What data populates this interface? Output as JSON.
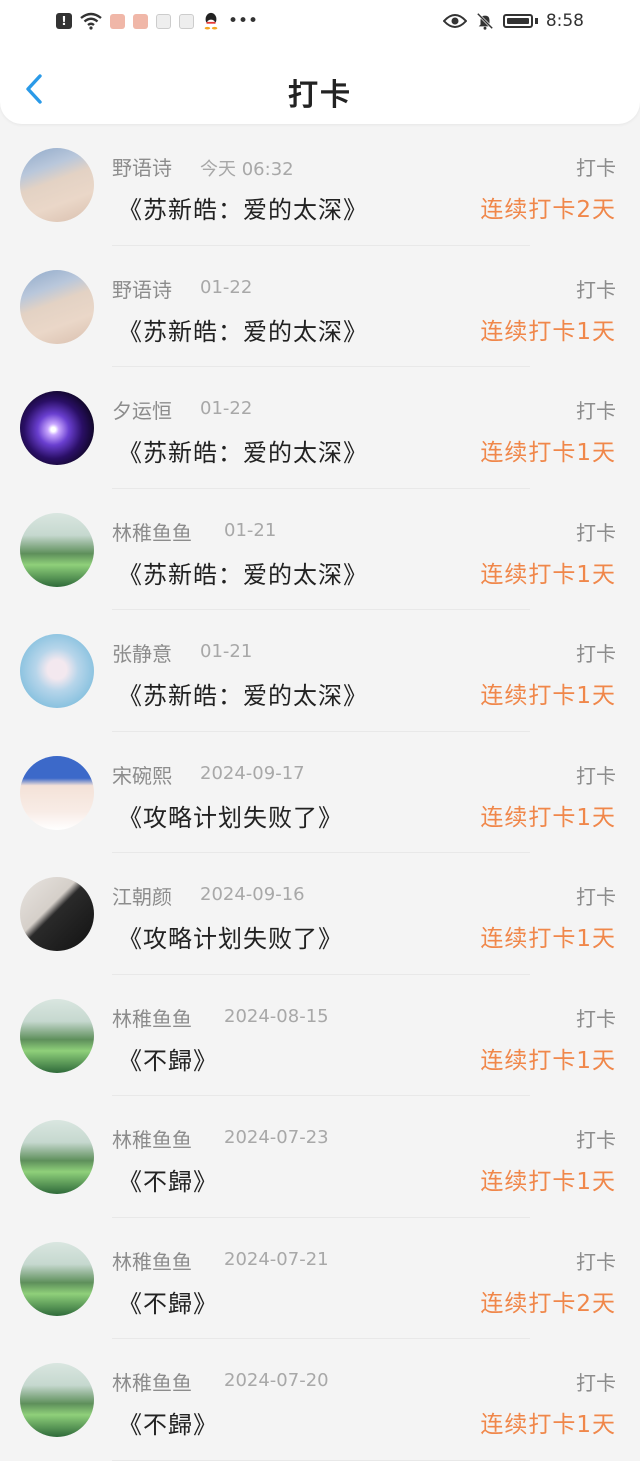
{
  "status_bar": {
    "time": "8:58",
    "left_icons": [
      "alert-icon",
      "wifi-icon",
      "app-icon",
      "app-icon",
      "app-icon",
      "app-icon",
      "qq-icon",
      "more-icon"
    ],
    "right_icons": [
      "eye-icon",
      "mute-icon",
      "battery-icon"
    ]
  },
  "header": {
    "title": "打卡"
  },
  "items": [
    {
      "name": "野语诗",
      "date": "今天 06:32",
      "tag": "打卡",
      "song": "《苏新皓：爱的太深》",
      "streak": "连续打卡2天",
      "avatar": "beach"
    },
    {
      "name": "野语诗",
      "date": "01-22",
      "tag": "打卡",
      "song": "《苏新皓：爱的太深》",
      "streak": "连续打卡1天",
      "avatar": "beach"
    },
    {
      "name": "夕运恒",
      "date": "01-22",
      "tag": "打卡",
      "song": "《苏新皓：爱的太深》",
      "streak": "连续打卡1天",
      "avatar": "galaxy"
    },
    {
      "name": "林稚鱼鱼",
      "date": "01-21",
      "tag": "打卡",
      "song": "《苏新皓：爱的太深》",
      "streak": "连续打卡1天",
      "avatar": "green"
    },
    {
      "name": "张静意",
      "date": "01-21",
      "tag": "打卡",
      "song": "《苏新皓：爱的太深》",
      "streak": "连续打卡1天",
      "avatar": "fairy"
    },
    {
      "name": "宋碗熙",
      "date": "2024-09-17",
      "tag": "打卡",
      "song": "《攻略计划失败了》",
      "streak": "连续打卡1天",
      "avatar": "flower"
    },
    {
      "name": "江朝颜",
      "date": "2024-09-16",
      "tag": "打卡",
      "song": "《攻略计划失败了》",
      "streak": "连续打卡1天",
      "avatar": "dark"
    },
    {
      "name": "林稚鱼鱼",
      "date": "2024-08-15",
      "tag": "打卡",
      "song": "《不歸》",
      "streak": "连续打卡1天",
      "avatar": "green"
    },
    {
      "name": "林稚鱼鱼",
      "date": "2024-07-23",
      "tag": "打卡",
      "song": "《不歸》",
      "streak": "连续打卡1天",
      "avatar": "green"
    },
    {
      "name": "林稚鱼鱼",
      "date": "2024-07-21",
      "tag": "打卡",
      "song": "《不歸》",
      "streak": "连续打卡2天",
      "avatar": "green"
    },
    {
      "name": "林稚鱼鱼",
      "date": "2024-07-20",
      "tag": "打卡",
      "song": "《不歸》",
      "streak": "连续打卡1天",
      "avatar": "green"
    }
  ],
  "colors": {
    "accent": "#2a9ae8",
    "streak": "#f0874a",
    "muted": "#8c8c8c"
  }
}
